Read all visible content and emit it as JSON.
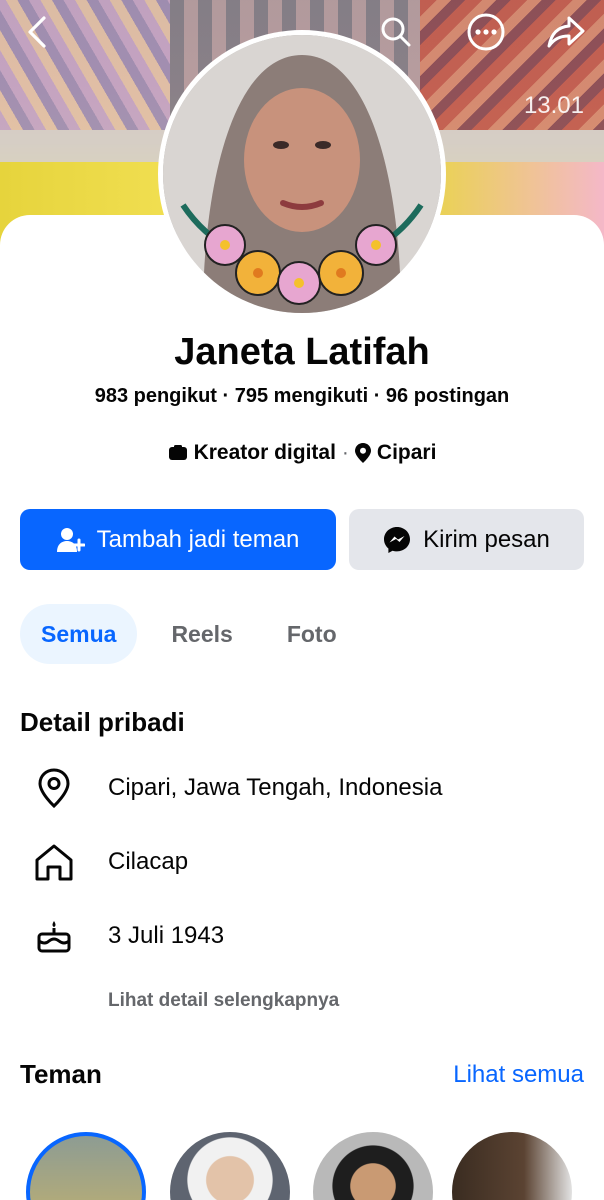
{
  "cover": {
    "time_overlay": "13.01"
  },
  "topbar": {
    "back_icon": "chevron-left-icon",
    "search_icon": "search-icon",
    "more_icon": "more-horizontal-icon",
    "share_icon": "share-icon"
  },
  "profile": {
    "name": "Janeta Latifah",
    "followers": "983 pengikut",
    "following": "795 mengikuti",
    "posts": "96 postingan",
    "category": "Kreator digital",
    "location": "Cipari"
  },
  "actions": {
    "add_friend": "Tambah jadi teman",
    "message": "Kirim pesan"
  },
  "tabs": [
    {
      "label": "Semua",
      "active": true
    },
    {
      "label": "Reels",
      "active": false
    },
    {
      "label": "Foto",
      "active": false
    }
  ],
  "details": {
    "title": "Detail pribadi",
    "items": [
      {
        "icon": "location-pin-icon",
        "text": "Cipari, Jawa Tengah, Indonesia"
      },
      {
        "icon": "home-icon",
        "text": "Cilacap"
      },
      {
        "icon": "birthday-cake-icon",
        "text": "3 Juli 1943"
      }
    ],
    "more": "Lihat detail selengkapnya"
  },
  "friends": {
    "title": "Teman",
    "see_all": "Lihat semua"
  },
  "colors": {
    "accent": "#0866ff",
    "secondary_button": "#e4e6eb",
    "active_tab_bg": "#ebf5ff",
    "muted_text": "#65676b"
  }
}
